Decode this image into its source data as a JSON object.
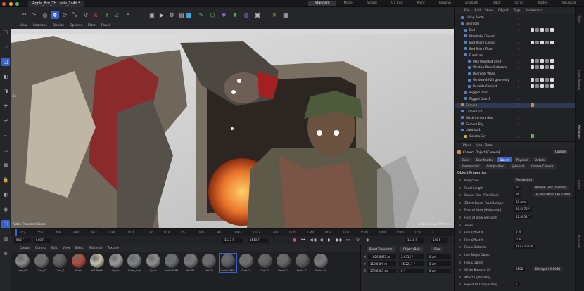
{
  "window": {
    "doc_tab": "Apple_Bot_Th...sets_1c4d *",
    "layouts": [
      "Standard",
      "Model",
      "Sculpt",
      "UV Edit",
      "Paint",
      "Rigging",
      "Animate",
      "Track",
      "Script",
      "Nodes",
      "Visualize"
    ],
    "active_layout": "Standard"
  },
  "toolbar": {
    "icons": [
      "undo-icon",
      "redo-icon",
      "live-select-icon",
      "move-icon",
      "rotate-icon",
      "scale-icon",
      "reset-icon",
      "x-axis-icon",
      "y-axis-icon",
      "z-axis-icon",
      "coordinate-icon",
      "render-region-icon",
      "render-view-icon",
      "render-settings-icon",
      "picture-viewer-icon",
      "cube-icon",
      "pen-icon",
      "generator-icon",
      "deformer-icon",
      "mograph-icon",
      "field-icon",
      "camera-icon",
      "light-icon",
      "scene-icon"
    ]
  },
  "viewport": {
    "menu": [
      "View",
      "Cameras",
      "Display",
      "Options",
      "Filter",
      "Panel"
    ],
    "label_left": "Video Transform Scene",
    "label_right": "Grid Spacing : 5000 cm",
    "label_top": "1x"
  },
  "timeline": {
    "ticks": [
      "552",
      "554",
      "449",
      "890",
      "952",
      "834",
      "1016",
      "1178",
      "1100",
      "852",
      "905",
      "993",
      "895",
      "1032",
      "1260",
      "1270",
      "1340",
      "1424",
      "1471",
      "1520",
      "1480",
      "1500",
      "1750",
      "F"
    ],
    "start_field": "540 F",
    "start_field2": "540 F",
    "current_frame": "1543 F",
    "current_frame2": "1543 F",
    "end_field": "1540 F",
    "end_field2": "540 F"
  },
  "materials": {
    "menu": [
      "Create",
      "Corona",
      "Edit",
      "View",
      "Select",
      "Material",
      "Texture"
    ],
    "items": [
      {
        "label": "Iced_01",
        "color": "#8a8a8a"
      },
      {
        "label": "Coat_T",
        "color": "#6f6f6f"
      },
      {
        "label": "Coat_T",
        "color": "#5a5a5a"
      },
      {
        "label": "Pves",
        "color": "#b54a3a"
      },
      {
        "label": "HB Teeth",
        "color": "#c9c0ac"
      },
      {
        "label": "Oycer",
        "color": "#9a9a9a"
      },
      {
        "label": "Steel_Ana",
        "color": "#7f848a"
      },
      {
        "label": "Oycer",
        "color": "#8e8e8e"
      },
      {
        "label": "Hat LEMM",
        "color": "#6b6e73"
      },
      {
        "label": "Hat 01",
        "color": "#787878"
      },
      {
        "label": "Hat 02",
        "color": "#6a6a6a"
      },
      {
        "label": "Coat LEMM",
        "color": "#5b5f66"
      },
      {
        "label": "Coat 01",
        "color": "#707070"
      },
      {
        "label": "Coat 02",
        "color": "#606060"
      },
      {
        "label": "Pants 01",
        "color": "#656565"
      },
      {
        "label": "Pants 02",
        "color": "#5d5d5d"
      },
      {
        "label": "Socks 01",
        "color": "#7a7a7a"
      }
    ]
  },
  "coords": {
    "reset_transform": "Reset Transform",
    "object_rel": "Object (Rel)",
    "size": "Size",
    "rows": [
      {
        "axis": "X",
        "pos": "-1026.0472 m",
        "rot": "2.0315 °",
        "size": "0 cm"
      },
      {
        "axis": "Y",
        "pos": "118.0409 m",
        "rot": "15.2217 °",
        "size": "0 cm"
      },
      {
        "axis": "Z",
        "pos": "373.6383 cm",
        "rot": "0 °",
        "size": "0 cm"
      }
    ]
  },
  "object_manager": {
    "menu": [
      "File",
      "Edit",
      "View",
      "Object",
      "Tags",
      "Bookmarks"
    ],
    "rows": [
      {
        "label": "Living Room",
        "indent": 1,
        "color": "#5b7fbf",
        "hl": false
      },
      {
        "label": "Bedroom",
        "indent": 1,
        "color": "#5b7fbf",
        "hl": false
      },
      {
        "label": "Bed",
        "indent": 2,
        "color": "#5b7fbf",
        "hl": false
      },
      {
        "label": "Wardrobe Closed",
        "indent": 2,
        "color": "#5b7fbf",
        "hl": false
      },
      {
        "label": "Bed Room Ceiling",
        "indent": 2,
        "color": "#5b7fbf",
        "hl": false
      },
      {
        "label": "Bed Room Floor",
        "indent": 2,
        "color": "#5b7fbf",
        "hl": false
      },
      {
        "label": "Furniture",
        "indent": 2,
        "color": "#5b7fbf",
        "hl": false
      },
      {
        "label": "Wall Mounted Shelf",
        "indent": 3,
        "color": "#5b7fbf",
        "hl": false
      },
      {
        "label": "Window Door Bedroom",
        "indent": 3,
        "color": "#5b7fbf",
        "hl": false
      },
      {
        "label": "Bedroom Walls",
        "indent": 3,
        "color": "#5b7fbf",
        "hl": false
      },
      {
        "label": "Window 46-28 geometry",
        "indent": 3,
        "color": "#5b7fbf",
        "hl": false
      },
      {
        "label": "Bedside Cabinet",
        "indent": 3,
        "color": "#5b7fbf",
        "hl": false
      },
      {
        "label": "Rigged Door",
        "indent": 2,
        "color": "#5b7fbf",
        "hl": false
      },
      {
        "label": "Rigged Door 1",
        "indent": 2,
        "color": "#5b7fbf",
        "hl": false
      },
      {
        "label": "Camera",
        "indent": 1,
        "color": "#d08a3a",
        "hl": true
      },
      {
        "label": "Camera TV",
        "indent": 1,
        "color": "#5b7fbf",
        "hl": false
      },
      {
        "label": "Black Camera Box",
        "indent": 1,
        "color": "#5b7fbf",
        "hl": false
      },
      {
        "label": "Camera Sky",
        "indent": 1,
        "color": "#5b7fbf",
        "hl": false
      },
      {
        "label": "Lighting 1",
        "indent": 1,
        "color": "#5b7fbf",
        "hl": false
      },
      {
        "label": "Corona Sky",
        "indent": 2,
        "color": "#d6b84a",
        "hl": false
      }
    ]
  },
  "attributes": {
    "menu": [
      "Mode",
      "User Data"
    ],
    "object_title": "Camera Object [Camera]",
    "preset": "Custom",
    "tabs_row1": [
      "Basic",
      "Coordinates",
      "Object",
      "Physical",
      "Details"
    ],
    "tabs_row2": [
      "Stereoscopic",
      "Composition",
      "Spherical",
      "Corona Camera"
    ],
    "active_tab": "Object",
    "section": "Object Properties",
    "props": [
      {
        "label": "Projection",
        "value": "Perspective",
        "extra": ""
      },
      {
        "label": "Focal Length",
        "value": "50",
        "extra": "Normal Lens (50 mm)"
      },
      {
        "label": "Sensor Size (Film Gate)",
        "value": "36",
        "extra": "35 mm Photo (36.0 mm)"
      },
      {
        "label": "35mm Equiv. Focal Length:",
        "value": "50 mm",
        "extra": ""
      },
      {
        "label": "Field of View (Horizontal)",
        "value": "39.5978 °",
        "extra": ""
      },
      {
        "label": "Field of View (Vertical)",
        "value": "22.8952 °",
        "extra": ""
      },
      {
        "label": "Zoom",
        "value": "",
        "extra": ""
      },
      {
        "label": "Film Offset X",
        "value": "0 %",
        "extra": ""
      },
      {
        "label": "Film Offset Y",
        "value": "0 %",
        "extra": ""
      },
      {
        "label": "Focus Distance",
        "value": "182.4764 m",
        "extra": ""
      },
      {
        "label": "Use Target Object",
        "value": "",
        "extra": ""
      },
      {
        "label": "Focus Object",
        "value": "",
        "extra": ""
      },
      {
        "label": "White Balance (K)",
        "value": "6500",
        "extra": "Daylight (6500 K)"
      },
      {
        "label": "Affect Lights Only",
        "value": "",
        "extra": ""
      },
      {
        "label": "Export to Compositing",
        "value": "✓",
        "extra": ""
      }
    ]
  },
  "sidebar_tabs": [
    "Takes",
    "Layer Browser",
    "Attributes",
    "Layers",
    "Structure"
  ]
}
